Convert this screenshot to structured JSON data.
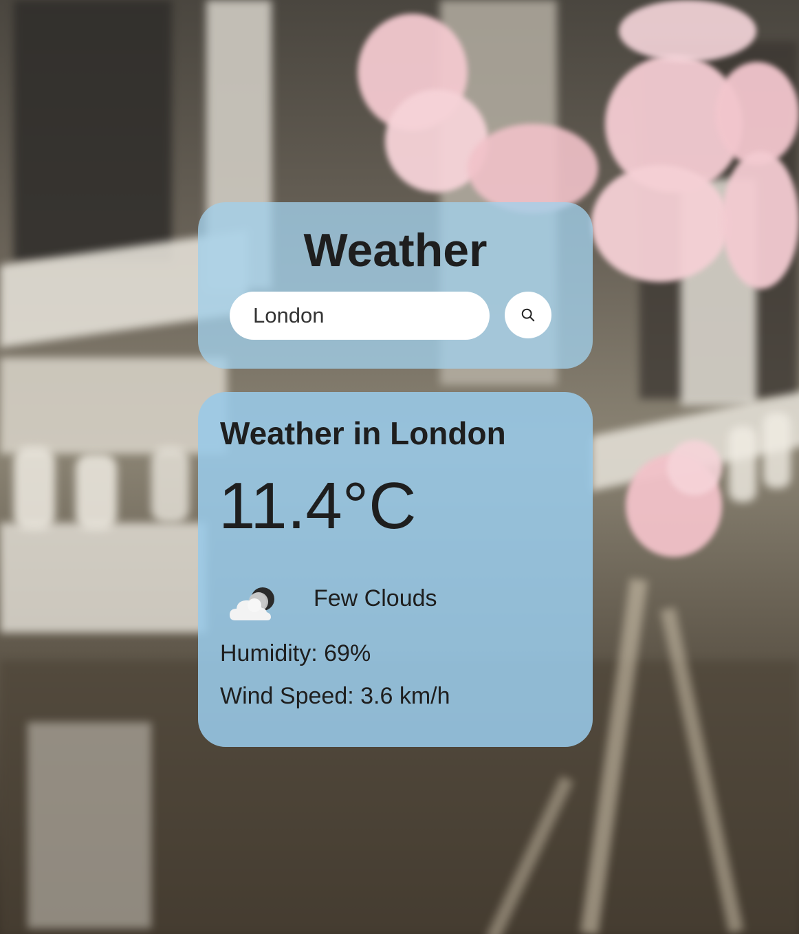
{
  "app": {
    "title": "Weather"
  },
  "search": {
    "value": "London",
    "button_icon": "search-icon"
  },
  "current": {
    "heading": "Weather in London",
    "temperature": "11.4°C",
    "icon": "few-clouds-night-icon",
    "description": "Few Clouds",
    "humidity": "Humidity: 69%",
    "wind": "Wind Speed: 3.6 km/h"
  },
  "colors": {
    "card_background": "#98cae8",
    "text": "#1e1e1e",
    "input_background": "#ffffff",
    "blossom": "#f2c4cc"
  }
}
